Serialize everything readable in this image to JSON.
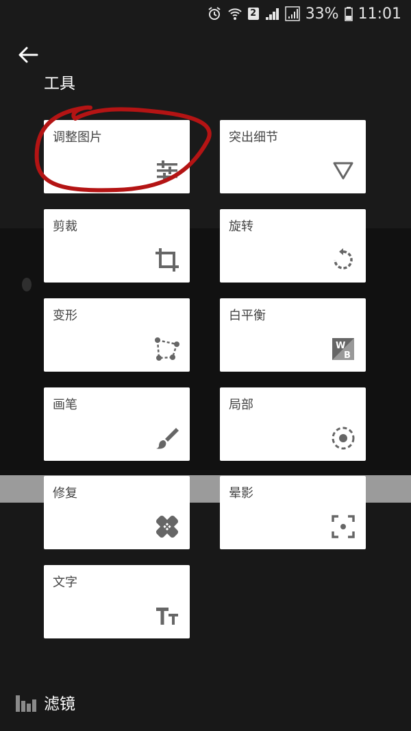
{
  "status_bar": {
    "sim": "2",
    "battery": "33%",
    "time": "11:01"
  },
  "header": {
    "title": "工具"
  },
  "tools": [
    {
      "label": "调整图片",
      "icon": "tune-sliders-icon"
    },
    {
      "label": "突出细节",
      "icon": "triangle-down-icon"
    },
    {
      "label": "剪裁",
      "icon": "crop-icon"
    },
    {
      "label": "旋转",
      "icon": "rotate-icon"
    },
    {
      "label": "变形",
      "icon": "perspective-icon"
    },
    {
      "label": "白平衡",
      "icon": "white-balance-icon"
    },
    {
      "label": "画笔",
      "icon": "brush-icon"
    },
    {
      "label": "局部",
      "icon": "selective-icon"
    },
    {
      "label": "修复",
      "icon": "healing-icon"
    },
    {
      "label": "晕影",
      "icon": "vignette-icon"
    },
    {
      "label": "文字",
      "icon": "text-icon"
    }
  ],
  "bottom": {
    "filters_label": "滤镜"
  },
  "colors": {
    "background": "#1a1a1a",
    "card": "#ffffff",
    "icon": "#666666",
    "annotation": "#b41414"
  }
}
